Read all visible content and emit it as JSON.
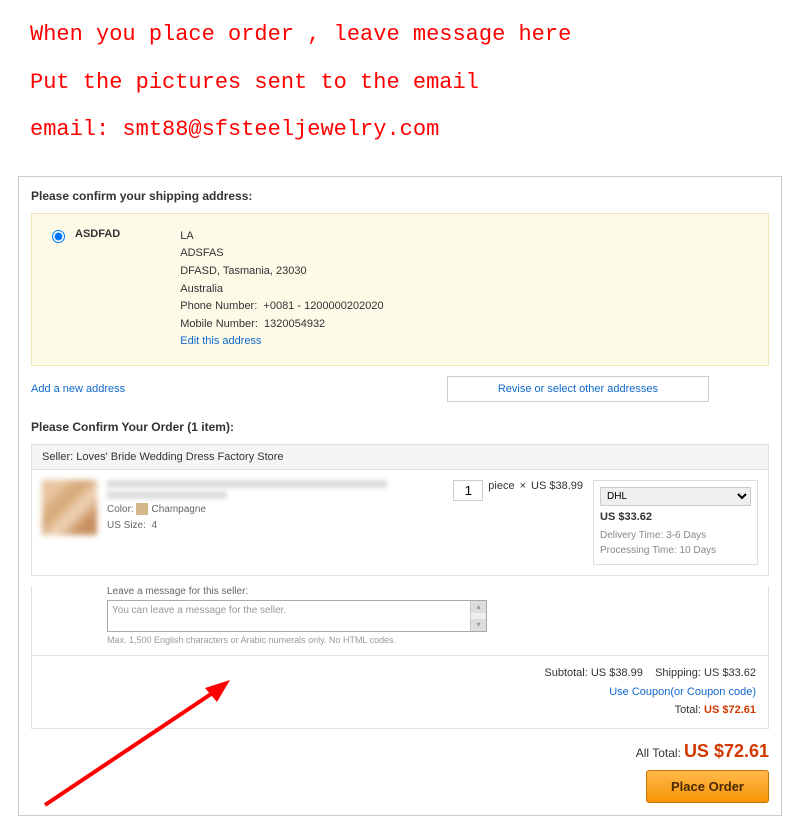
{
  "annotations": {
    "line1": "When you place order , leave message here",
    "line2": "Put the pictures sent to the email",
    "line3": "email:  smt88@sfsteeljewelry.com"
  },
  "shipping": {
    "title": "Please confirm your shipping address:",
    "name": "ASDFAD",
    "city": "LA",
    "line2": "ADSFAS",
    "line3": "DFASD, Tasmania, 23030",
    "country": "Australia",
    "phone_label": "Phone Number:",
    "phone": "+0081 - 1200000202020",
    "mobile_label": "Mobile Number:",
    "mobile": "1320054932",
    "edit_link": "Edit this address",
    "add_link": "Add a new address",
    "revise_btn": "Revise or select other addresses"
  },
  "order": {
    "title": "Please Confirm Your Order (1 item):",
    "seller_label": "Seller: Loves' Bride Wedding Dress Factory Store",
    "color_label": "Color:",
    "color_value": "Champagne",
    "size_label": "US Size:",
    "size_value": "4",
    "qty": "1",
    "unit": "piece",
    "mult": "×",
    "unit_price": "US $38.99",
    "shipping_method": "DHL",
    "shipping_price": "US $33.62",
    "delivery_label": "Delivery Time:",
    "delivery_value": "3-6 Days",
    "processing_label": "Processing Time:",
    "processing_value": "10 Days",
    "msg_label": "Leave a message for this seller:",
    "msg_placeholder": "You can leave a message for the seller.",
    "msg_note": "Max. 1,500 English characters or Arabic numerals only. No HTML codes.",
    "subtotal_label": "Subtotal:",
    "subtotal": "US $38.99",
    "ship_label": "Shipping:",
    "ship_total": "US $33.62",
    "coupon": "Use Coupon(or Coupon code)",
    "total_label": "Total:",
    "total": "US $72.61"
  },
  "grand": {
    "label": "All Total:",
    "amount": "US $72.61",
    "button": "Place Order"
  }
}
